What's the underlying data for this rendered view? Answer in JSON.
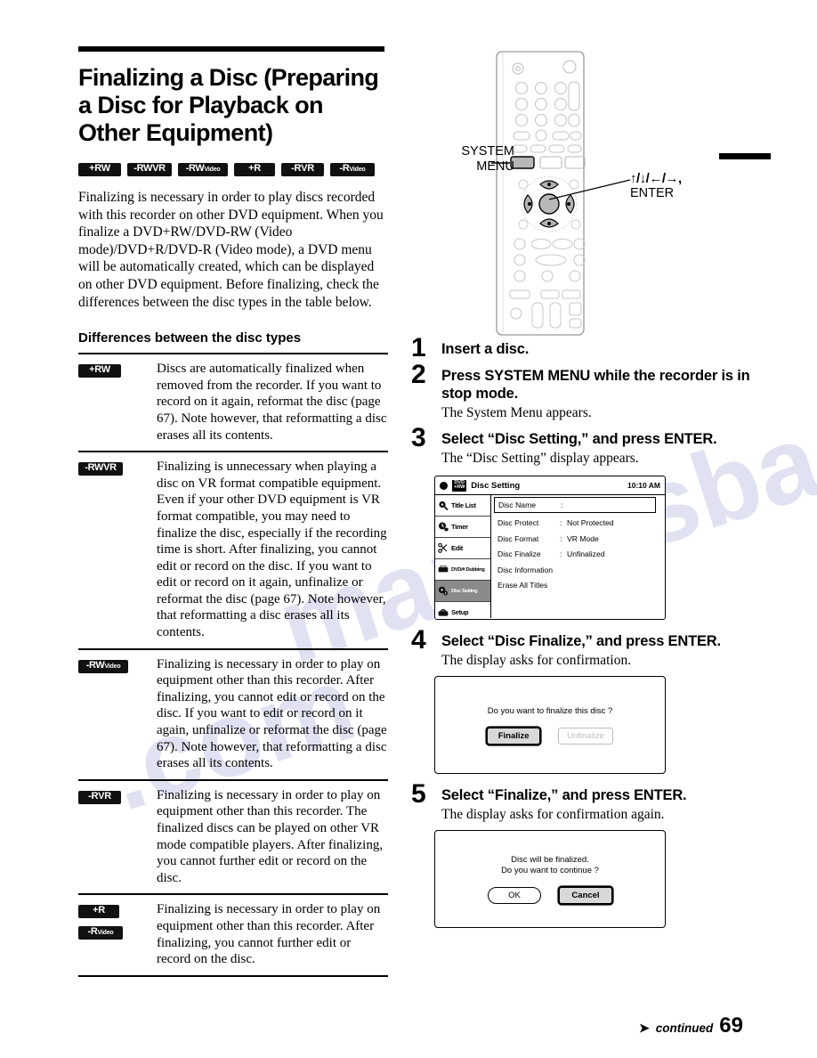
{
  "page": {
    "number": "69",
    "continued_label": "continued",
    "arrow_icon": "right-arrow-icon"
  },
  "left": {
    "title": "Finalizing a Disc (Preparing a Disc for Playback on Other Equipment)",
    "badges": [
      {
        "main": "+RW",
        "sub": ""
      },
      {
        "main": "-RW",
        "sub": "VR"
      },
      {
        "main": "-RW",
        "sub": "Video"
      },
      {
        "main": "+R",
        "sub": ""
      },
      {
        "main": "-R",
        "sub": "VR"
      },
      {
        "main": "-R",
        "sub": "Video"
      }
    ],
    "intro": "Finalizing is necessary in order to play discs recorded with this recorder on other DVD equipment.\nWhen you finalize a DVD+RW/DVD-RW (Video mode)/DVD+R/DVD-R (Video mode), a DVD menu will be automatically created, which can be displayed on other DVD equipment.\nBefore finalizing, check the differences between the disc types in the table below.",
    "table_heading": "Differences between the disc types",
    "table_rows": [
      {
        "badges": [
          {
            "main": "+RW",
            "sub": ""
          }
        ],
        "text": "Discs are automatically finalized when removed from the recorder. If you want to record on it again, reformat the disc (page 67). Note however, that reformatting a disc erases all its contents."
      },
      {
        "badges": [
          {
            "main": "-RW",
            "sub": "VR"
          }
        ],
        "text": "Finalizing is unnecessary when playing a disc on VR format compatible equipment. Even if your other DVD equipment is VR format compatible, you may need to finalize the disc, especially if the recording time is short. After finalizing, you cannot edit or record on the disc. If you want to edit or record on it again, unfinalize or reformat the disc (page 67). Note however, that reformatting a disc erases all its contents."
      },
      {
        "badges": [
          {
            "main": "-RW",
            "sub": "Video"
          }
        ],
        "text": "Finalizing is necessary in order to play on equipment other than this recorder. After finalizing, you cannot edit or record on the disc. If you want to edit or record on it again, unfinalize or reformat the disc (page 67). Note however, that reformatting a disc erases all its contents."
      },
      {
        "badges": [
          {
            "main": "-R",
            "sub": "VR"
          }
        ],
        "text": "Finalizing is necessary in order to play on equipment other than this recorder. The finalized discs can be played on other VR mode compatible players. After finalizing, you cannot further edit or record on the disc."
      },
      {
        "badges": [
          {
            "main": "+R",
            "sub": ""
          },
          {
            "main": "-R",
            "sub": "Video"
          }
        ],
        "text": "Finalizing is necessary in order to play on equipment other than this recorder. After finalizing, you cannot further edit or record on the disc."
      }
    ]
  },
  "right": {
    "remote": {
      "callout_system_menu": "SYSTEM\nMENU",
      "callout_system_menu_line1": "SYSTEM",
      "callout_system_menu_line2": "MENU",
      "callout_enter_arrows": "↑/↓/←/→,",
      "callout_enter_label": "ENTER"
    },
    "steps": [
      {
        "num": "1",
        "title": "Insert a disc.",
        "note": ""
      },
      {
        "num": "2",
        "title": "Press SYSTEM MENU while the recorder is in stop mode.",
        "note": "The System Menu appears."
      },
      {
        "num": "3",
        "title": "Select “Disc Setting,” and press ENTER.",
        "note": "The “Disc Setting” display appears."
      },
      {
        "num": "4",
        "title": "Select “Disc Finalize,” and press ENTER.",
        "note": "The display asks for confirmation."
      },
      {
        "num": "5",
        "title": "Select “Finalize,” and press ENTER.",
        "note": "The display asks for confirmation again."
      }
    ],
    "osd": {
      "disc_logo_line1": "DVD",
      "disc_logo_line2": "+RW",
      "title": "Disc Setting",
      "time": "10:10 AM",
      "sidebar": [
        {
          "label": "Title List",
          "icon": "disc-magnifier-icon",
          "active": false,
          "small": false
        },
        {
          "label": "Timer",
          "icon": "clock-icon",
          "active": false,
          "small": false
        },
        {
          "label": "Edit",
          "icon": "scissors-icon",
          "active": false,
          "small": false
        },
        {
          "label": "DVD/# Dubbing",
          "icon": "dubbing-icon",
          "active": false,
          "small": true
        },
        {
          "label": "Disc Setting",
          "icon": "disc-setting-icon",
          "active": true,
          "small": true
        },
        {
          "label": "Setup",
          "icon": "toolbox-icon",
          "active": false,
          "small": false
        }
      ],
      "rows": [
        {
          "key": "Disc Name",
          "colon": ":",
          "value": "",
          "boxed": true
        },
        {
          "key": "Disc Protect",
          "colon": ":",
          "value": "Not Protected",
          "boxed": false
        },
        {
          "key": "Disc Format",
          "colon": ":",
          "value": "VR Mode",
          "boxed": false
        },
        {
          "key": "Disc Finalize",
          "colon": ":",
          "value": "Unfinalized",
          "boxed": false
        },
        {
          "key": "Disc Information",
          "colon": "",
          "value": "",
          "boxed": false
        },
        {
          "key": "Erase All Titles",
          "colon": "",
          "value": "",
          "boxed": false
        }
      ]
    },
    "dialog4": {
      "message": "Do you want to finalize this disc ?",
      "button_primary": "Finalize",
      "button_secondary": "Unfinalize"
    },
    "dialog5": {
      "message_line1": "Disc will be finalized.",
      "message_line2": "Do you want to continue ?",
      "button_ok": "OK",
      "button_cancel": "Cancel"
    }
  }
}
